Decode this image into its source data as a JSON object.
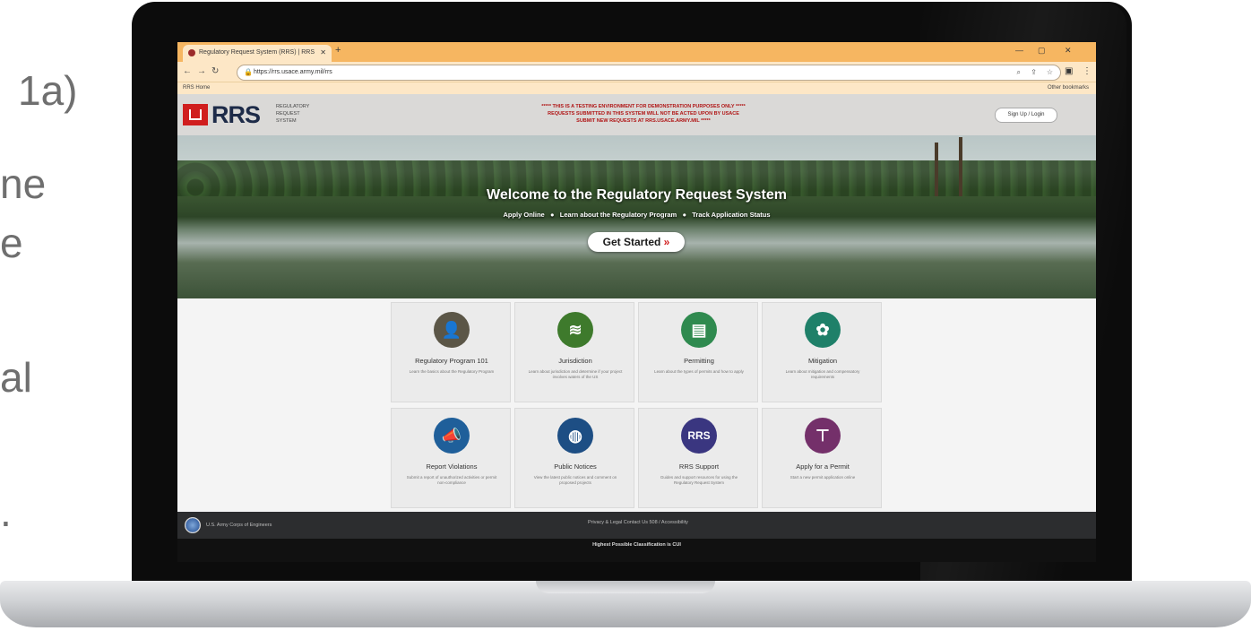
{
  "slide_text": [
    "1a)",
    "ne",
    "e",
    "al",
    "."
  ],
  "browser": {
    "tab_title": "Regulatory Request System (RRS) | RRS",
    "url": "https://rrs.usace.army.mil/rrs",
    "bookmarks_left": "RRS Home",
    "bookmarks_right": "Other bookmarks"
  },
  "site": {
    "logo_text": "RRS",
    "logo_sub": [
      "REGULATORY",
      "REQUEST",
      "SYSTEM"
    ],
    "notice": [
      "***** THIS IS A TESTING ENVIRONMENT FOR DEMONSTRATION PURPOSES ONLY *****",
      "REQUESTS SUBMITTED IN THIS SYSTEM WILL NOT BE ACTED UPON BY USACE",
      "SUBMIT NEW REQUESTS AT RRS.USACE.ARMY.MIL *****"
    ],
    "signup_label": "Sign Up / Login"
  },
  "hero": {
    "title": "Welcome to the Regulatory Request System",
    "links": [
      "Apply Online",
      "Learn about the Regulatory Program",
      "Track Application Status"
    ],
    "cta": "Get Started"
  },
  "cards": [
    {
      "title": "Regulatory Program 101",
      "desc": "Learn the basics about the Regulatory Program",
      "icon": "people-icon",
      "glyph": "👤",
      "color": "#5b5647"
    },
    {
      "title": "Jurisdiction",
      "desc": "Learn about jurisdiction and determine if your project involves waters of the US",
      "icon": "river-icon",
      "glyph": "≋",
      "color": "#3e7a2c"
    },
    {
      "title": "Permitting",
      "desc": "Learn about the types of permits and how to apply",
      "icon": "document-icon",
      "glyph": "▤",
      "color": "#2f8a4f"
    },
    {
      "title": "Mitigation",
      "desc": "Learn about mitigation and compensatory requirements",
      "icon": "plant-icon",
      "glyph": "✿",
      "color": "#1f8069"
    },
    {
      "title": "Report Violations",
      "desc": "Submit a report of unauthorized activities or permit non-compliance",
      "icon": "megaphone-icon",
      "glyph": "📣",
      "color": "#1f5f9a"
    },
    {
      "title": "Public Notices",
      "desc": "View the latest public notices and comment on proposed projects",
      "icon": "globe-icon",
      "glyph": "◍",
      "color": "#1d4e84"
    },
    {
      "title": "RRS Support",
      "desc": "Guides and support resources for using the Regulatory Request System",
      "icon": "rrs-icon",
      "glyph": "RRS",
      "color": "#3a3680"
    },
    {
      "title": "Apply for a Permit",
      "desc": "Start a new permit application online",
      "icon": "sign-icon",
      "glyph": "⊤",
      "color": "#74306a"
    }
  ],
  "footer": {
    "left": "U.S. Army Corps of Engineers",
    "mid": "Privacy & Legal   Contact Us   508 / Accessibility",
    "classification": "Highest Possible Classification is CUI"
  }
}
